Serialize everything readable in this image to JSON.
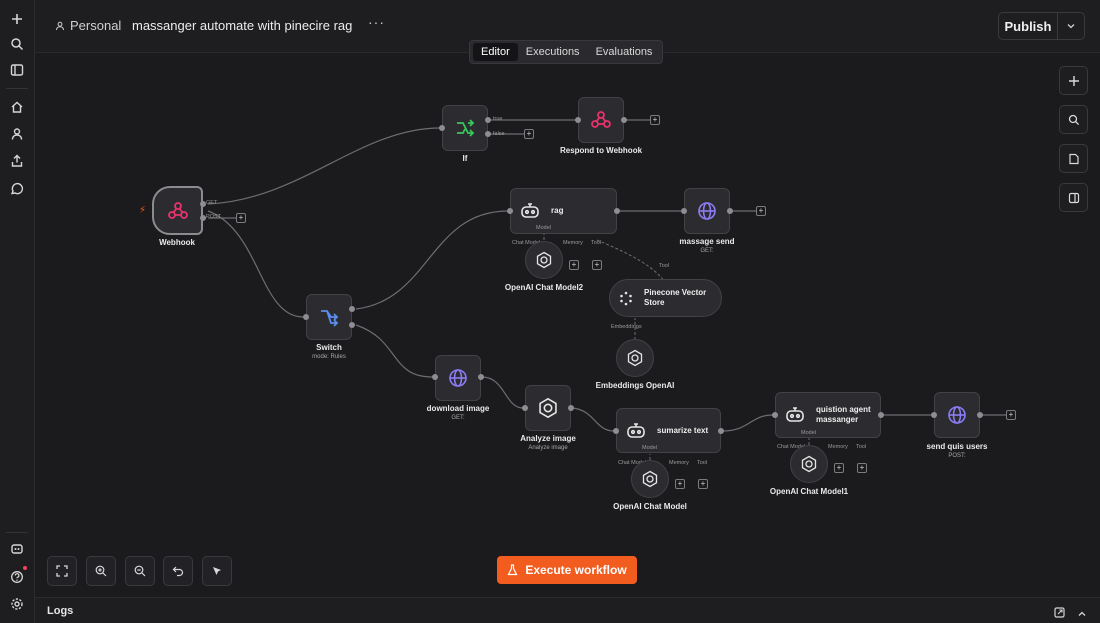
{
  "header": {
    "project": "Personal",
    "workflow_title": "massanger automate with pinecire rag",
    "more": "···",
    "publish_label": "Publish"
  },
  "tabs": [
    {
      "label": "Editor",
      "active": true
    },
    {
      "label": "Executions",
      "active": false
    },
    {
      "label": "Evaluations",
      "active": false
    }
  ],
  "nodes": {
    "if": {
      "label": "If",
      "out_true": "true",
      "out_false": "false"
    },
    "respond": {
      "label": "Respond to Webhook"
    },
    "webhook": {
      "label": "Webhook",
      "out_get": "GET",
      "out_post": "POST"
    },
    "rag": {
      "label": "rag",
      "model": "Model",
      "chat_model": "Chat Model",
      "memory": "Memory",
      "tool": "Tool"
    },
    "massage_send": {
      "label": "massage send",
      "sub": "GET:"
    },
    "openai_chat_model2": {
      "label": "OpenAI Chat Model2"
    },
    "pinecone": {
      "label": "Pinecone Vector Store",
      "tool": "Tool",
      "embeddings": "Embeddings"
    },
    "embeddings_openai": {
      "label": "Embeddings OpenAI"
    },
    "switch": {
      "label": "Switch",
      "sub": "mode: Rules"
    },
    "download_image": {
      "label": "download image",
      "sub": "GET:"
    },
    "analyze_image": {
      "label": "Analyze image",
      "sub": "Analyze image"
    },
    "sumarize": {
      "label": "sumarize text",
      "model": "Model",
      "chat_model": "Chat Model",
      "memory": "Memory",
      "tool": "Tool"
    },
    "openai_chat_model": {
      "label": "OpenAI Chat Model"
    },
    "quistion": {
      "label": "quistion agent massanger",
      "model": "Model",
      "chat_model": "Chat Model",
      "memory": "Memory",
      "tool": "Tool"
    },
    "openai_chat_model1": {
      "label": "OpenAI Chat Model1"
    },
    "send_quis": {
      "label": "send quis users",
      "sub": "POST:"
    }
  },
  "execute_label": "Execute workflow",
  "logs_label": "Logs",
  "colors": {
    "accent": "#f25c1f",
    "webhook": "#e8336d",
    "if": "#35c759",
    "switch": "#5b8def",
    "http": "#8b7cf6"
  }
}
